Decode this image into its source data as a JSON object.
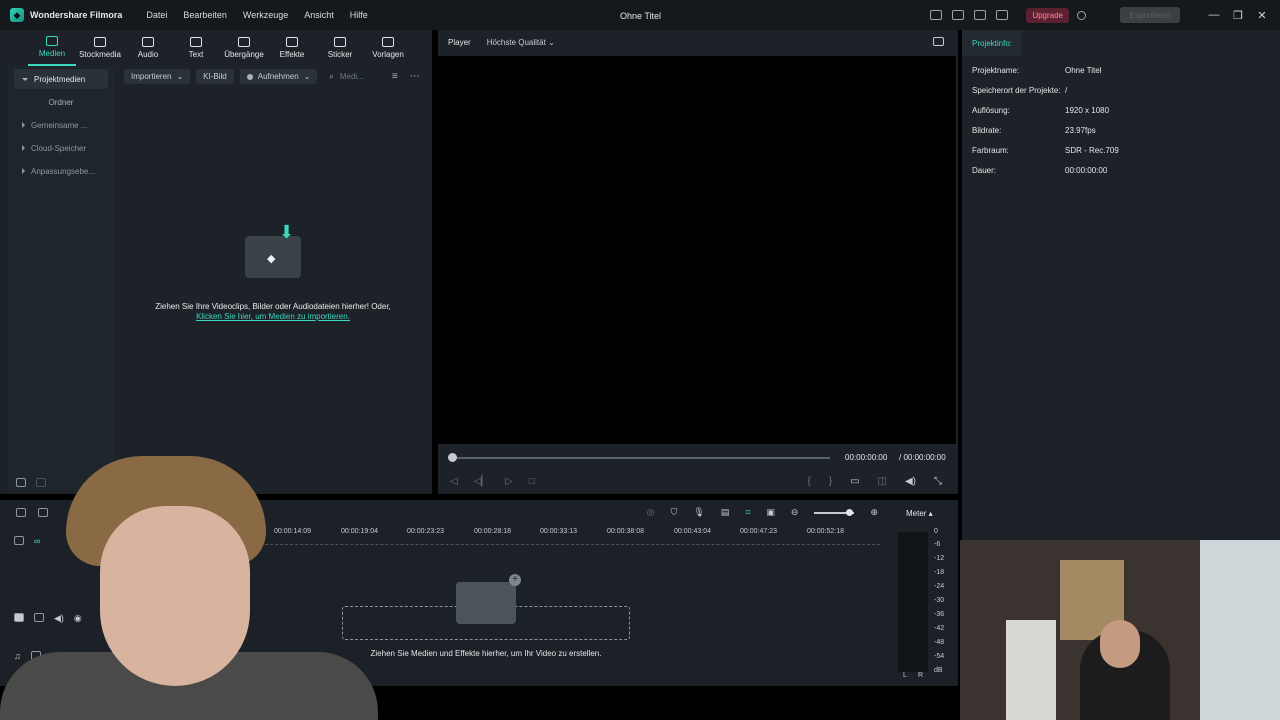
{
  "titlebar": {
    "app_name": "Wondershare Filmora",
    "menu": [
      "Datei",
      "Bearbeiten",
      "Werkzeuge",
      "Ansicht",
      "Hilfe"
    ],
    "doc_title": "Ohne Titel",
    "upgrade": "Upgrade",
    "export": "Exportieren",
    "min": "—",
    "max": "❐",
    "close": "✕"
  },
  "tools": [
    {
      "label": "Medien"
    },
    {
      "label": "Stockmedia"
    },
    {
      "label": "Audio"
    },
    {
      "label": "Text"
    },
    {
      "label": "Übergänge"
    },
    {
      "label": "Effekte"
    },
    {
      "label": "Sticker"
    },
    {
      "label": "Vorlagen"
    }
  ],
  "sidebar": {
    "project_media": "Projektmedien",
    "folder": "Ordner",
    "shared": "Gemeinsame ...",
    "cloud": "Cloud-Speicher",
    "adjust": "Anpassungsebe..."
  },
  "media_toolbar": {
    "import": "Importieren",
    "ai_image": "KI-Bild",
    "record": "Aufnehmen",
    "search_placeholder": "Medi..."
  },
  "empty_state": {
    "text": "Ziehen Sie Ihre Videoclips, Bilder oder Audiodateien hierher! Oder,",
    "link": "Klicken Sie hier, um Medien zu importieren."
  },
  "player": {
    "tab": "Player",
    "quality": "Höchste Qualität",
    "current_time": "00:00:00:00",
    "total_time": "/  00:00:00:00"
  },
  "project_info": {
    "tab": "Projektinfo:",
    "rows": [
      {
        "key": "Projektname:",
        "value": "Ohne Titel"
      },
      {
        "key": "Speicherort der Projekte:",
        "value": "/"
      },
      {
        "key": "Auflösung:",
        "value": "1920 x 1080"
      },
      {
        "key": "Bildrate:",
        "value": "23.97fps"
      },
      {
        "key": "Farbraum:",
        "value": "SDR - Rec.709"
      },
      {
        "key": "Dauer:",
        "value": "00:00:00:00"
      }
    ]
  },
  "timeline": {
    "ruler": [
      "00:00:14:09",
      "00:00:19:04",
      "00:00:23:23",
      "00:00:28:18",
      "00:00:33:13",
      "00:00:38:08",
      "00:00:43:04",
      "00:00:47:23",
      "00:00:52:18"
    ],
    "drop_text": "Ziehen Sie Medien und Effekte hierher, um Ihr Video zu erstellen.",
    "meter_label": "Meter ▴",
    "db_scale": [
      "0",
      "-6",
      "-12",
      "-18",
      "-24",
      "-30",
      "-36",
      "-42",
      "-48",
      "-54",
      "dB"
    ],
    "left": "L",
    "right": "R"
  }
}
